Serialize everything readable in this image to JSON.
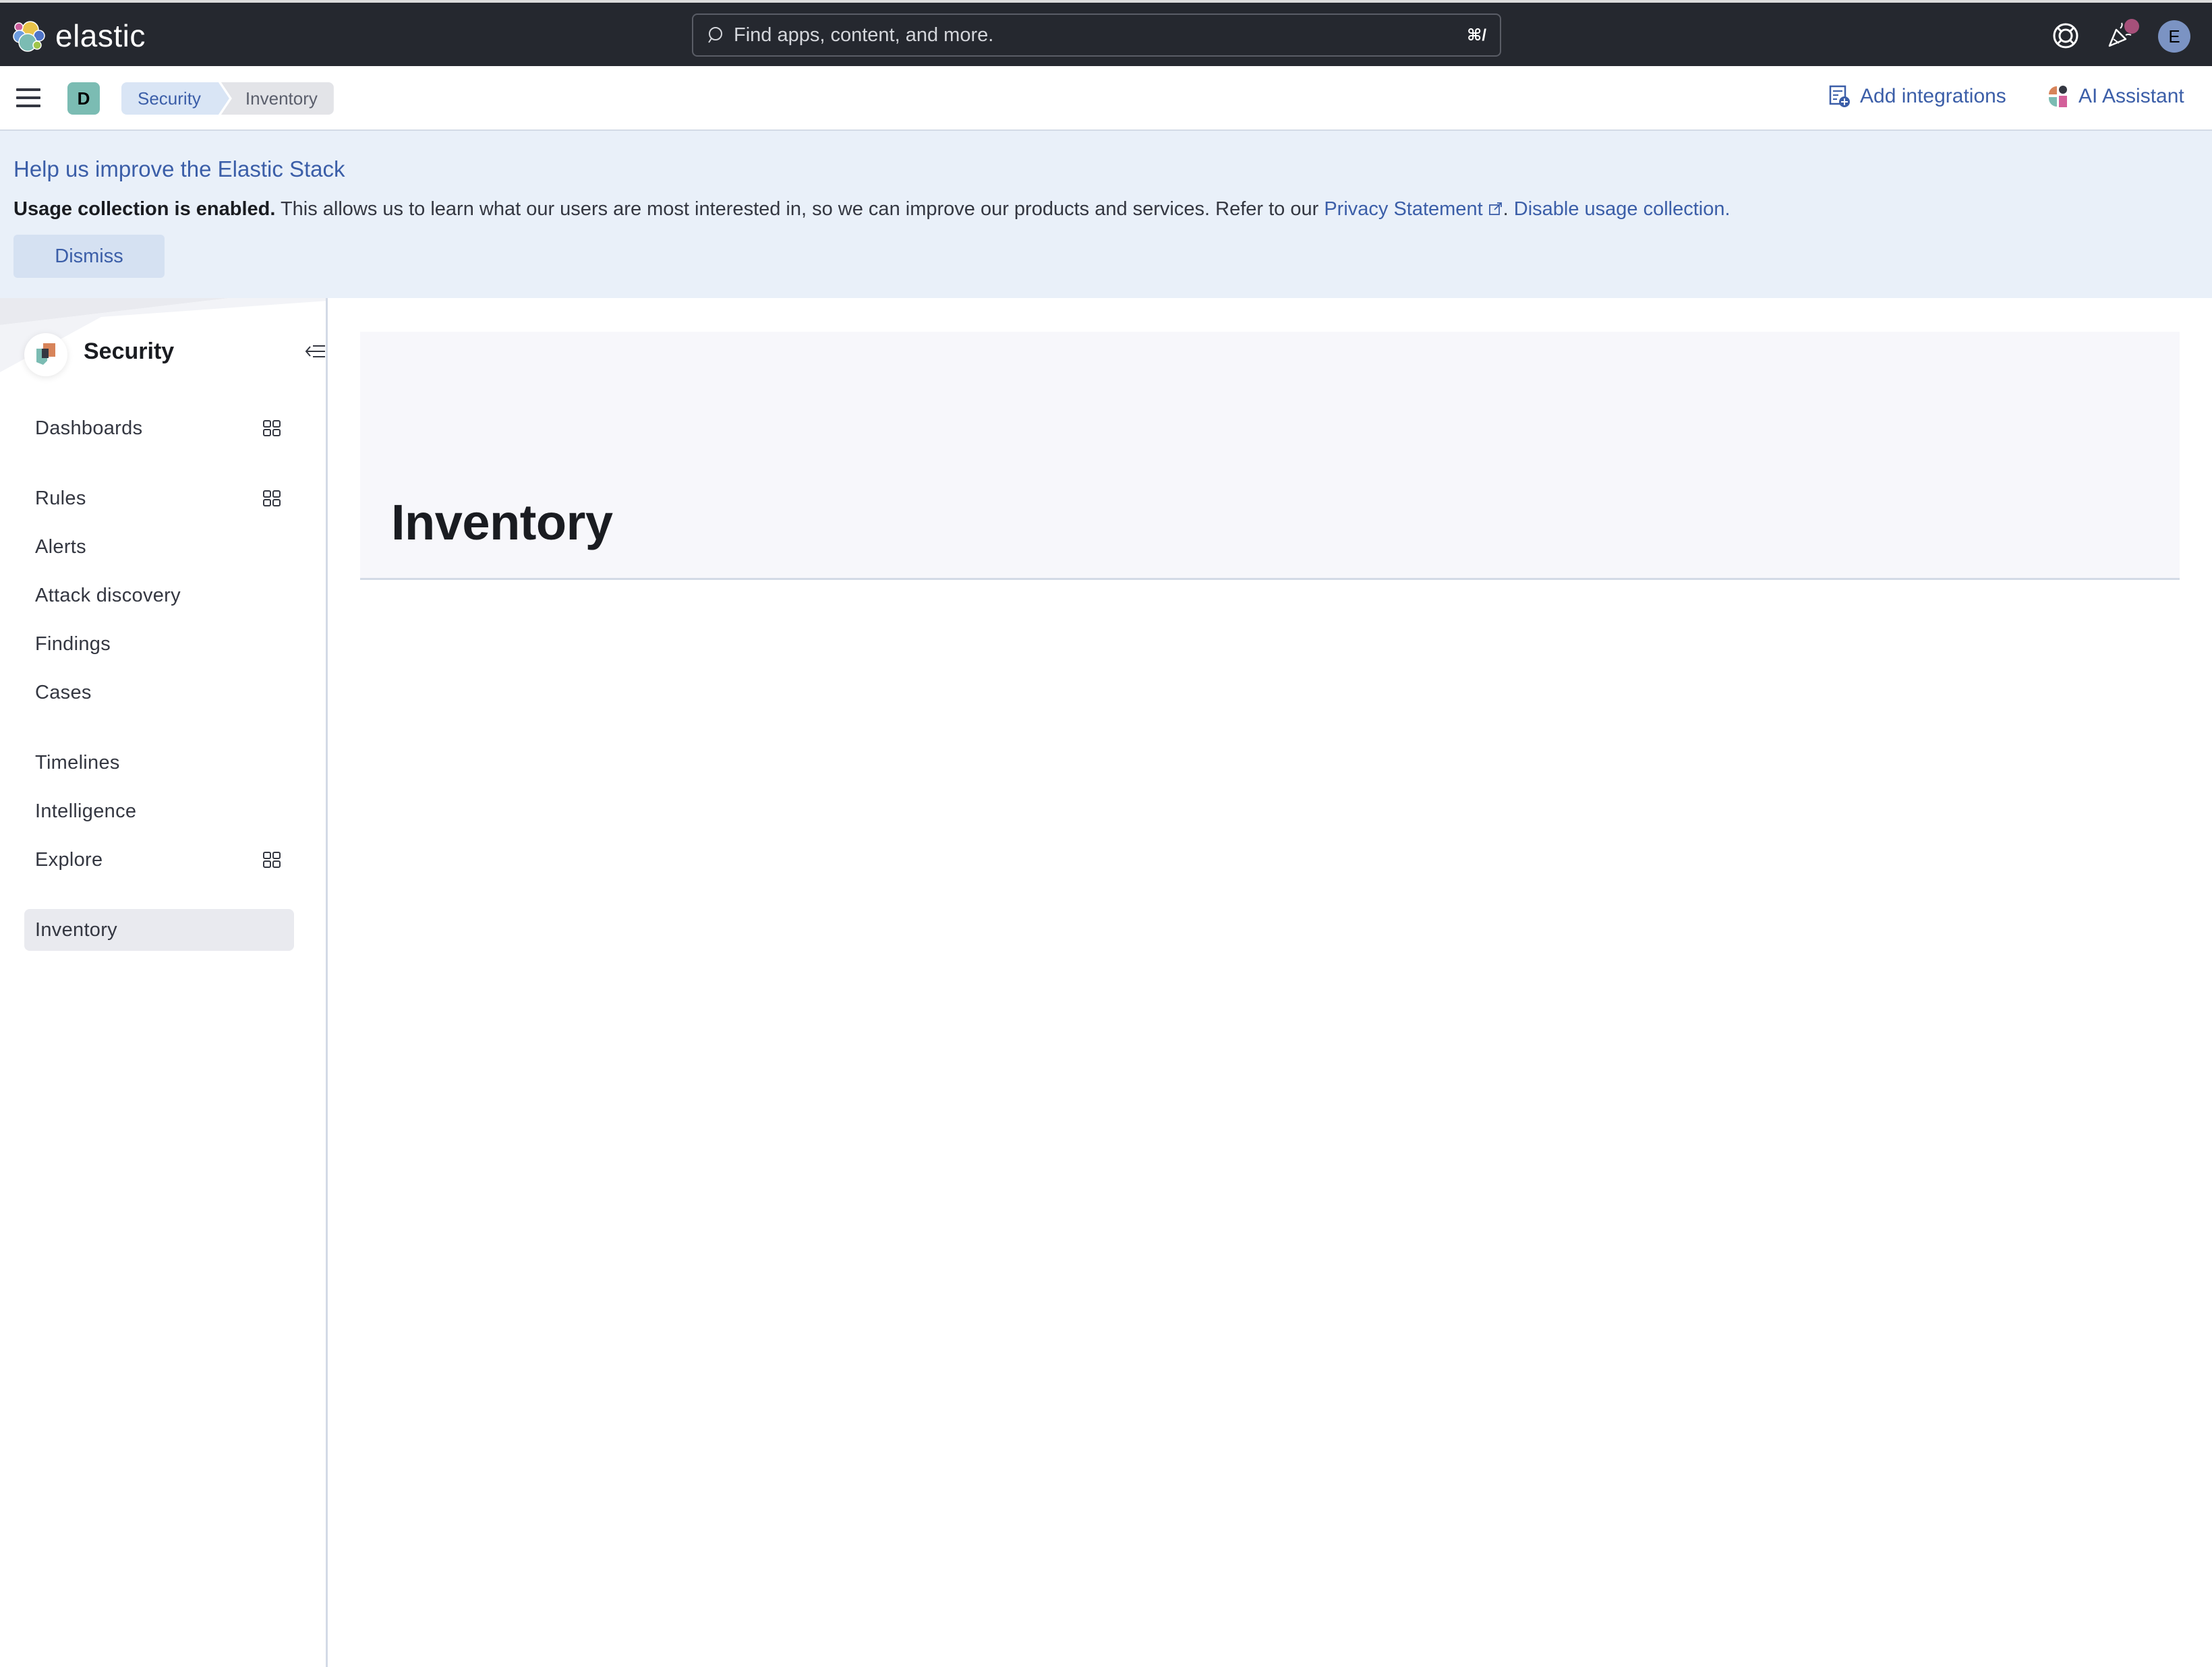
{
  "header": {
    "brand": "elastic",
    "search": {
      "placeholder": "Find apps, content, and more.",
      "shortcut": "⌘/"
    },
    "icons": [
      "help-icon",
      "news-feed-icon"
    ],
    "user_avatar_initial": "E",
    "notification_dot_color": "#a6507a"
  },
  "breadcrumb_bar": {
    "space_initial": "D",
    "breadcrumbs": [
      {
        "label": "Security"
      },
      {
        "label": "Inventory"
      }
    ],
    "actions": {
      "add_integrations": "Add integrations",
      "ai_assistant": "AI Assistant"
    }
  },
  "banner": {
    "title": "Help us improve the Elastic Stack",
    "bold_text": "Usage collection is enabled.",
    "text": " This allows us to learn what our users are most interested in, so we can improve our products and services. Refer to our ",
    "privacy_link": "Privacy Statement",
    "separator": ".",
    "disable_link": "Disable usage collection.",
    "dismiss_label": "Dismiss"
  },
  "sidebar": {
    "title": "Security",
    "items": [
      {
        "label": "Dashboards",
        "has_panel": true
      },
      {
        "label": "Rules",
        "has_panel": true
      },
      {
        "label": "Alerts",
        "has_panel": false
      },
      {
        "label": "Attack discovery",
        "has_panel": false
      },
      {
        "label": "Findings",
        "has_panel": false
      },
      {
        "label": "Cases",
        "has_panel": false
      },
      {
        "label": "Timelines",
        "has_panel": false
      },
      {
        "label": "Intelligence",
        "has_panel": false
      },
      {
        "label": "Explore",
        "has_panel": true
      },
      {
        "label": "Inventory",
        "has_panel": false,
        "active": true
      }
    ]
  },
  "main": {
    "page_title": "Inventory"
  },
  "colors": {
    "accent": "#3b5ea8",
    "header_bg": "#25282f",
    "banner_bg": "#e9f0f9"
  }
}
